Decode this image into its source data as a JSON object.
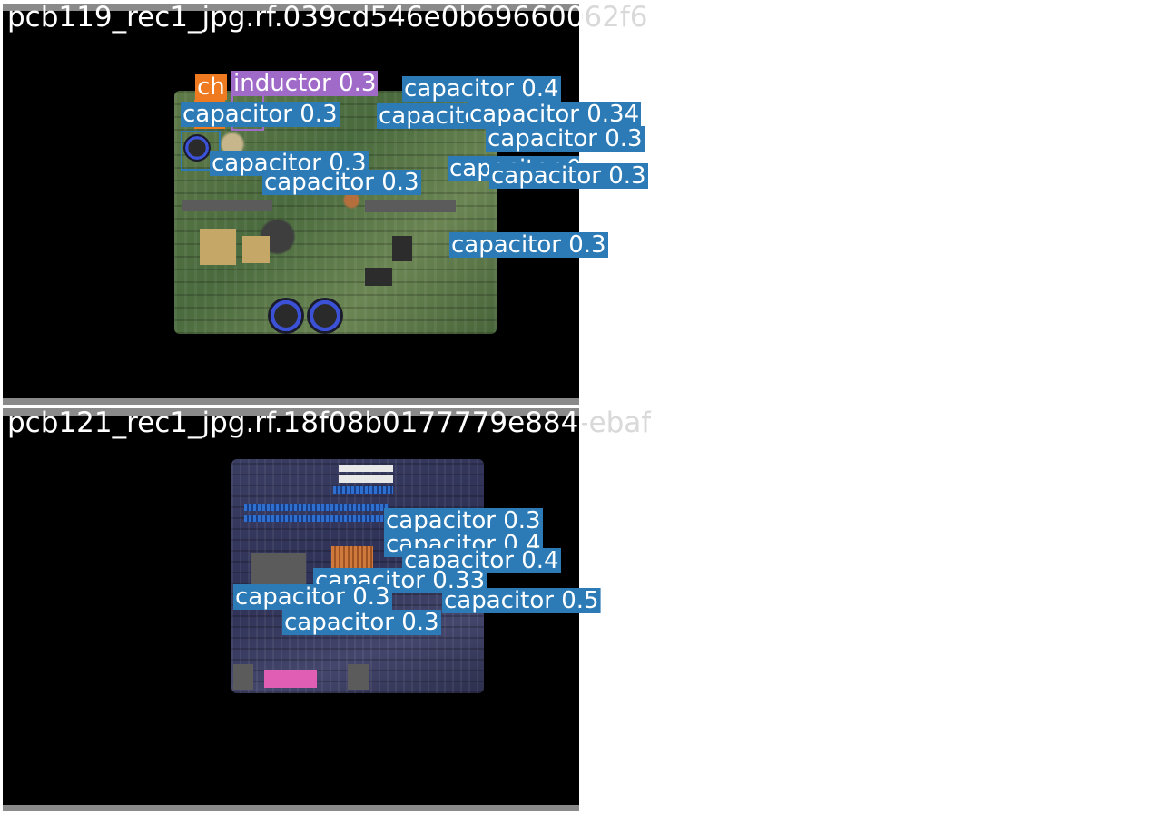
{
  "images": [
    {
      "title": "pcb119_rec1_jpg.rf.039cd546e0b69660062f6",
      "labels": [
        "ch",
        "inductor 0.3",
        "capacitor 0.4",
        "capacitor 0.3",
        "capacitor 0.3",
        "capacitor 0.34",
        "capacitor 0.3",
        "capacitor 0.3",
        "capacitor 0.3",
        "capacitor 0.3",
        "capacitor 0.3",
        "capacitor 0.3"
      ]
    },
    {
      "title": "pcb121_rec1_jpg.rf.18f08b0177779e884-ebaf",
      "labels": [
        "capacitor 0.3",
        "capacitor 0.4",
        "capacitor 0.4",
        "capacitor 0.33",
        "capacitor 0.3",
        "capacitor 0.5",
        "capacitor 0.3"
      ]
    }
  ],
  "colors": {
    "capacitor_box": "#2c7bb6",
    "chip_box": "#ef7a1f",
    "inductor_box": "#a06bc8",
    "background": "#000000"
  }
}
